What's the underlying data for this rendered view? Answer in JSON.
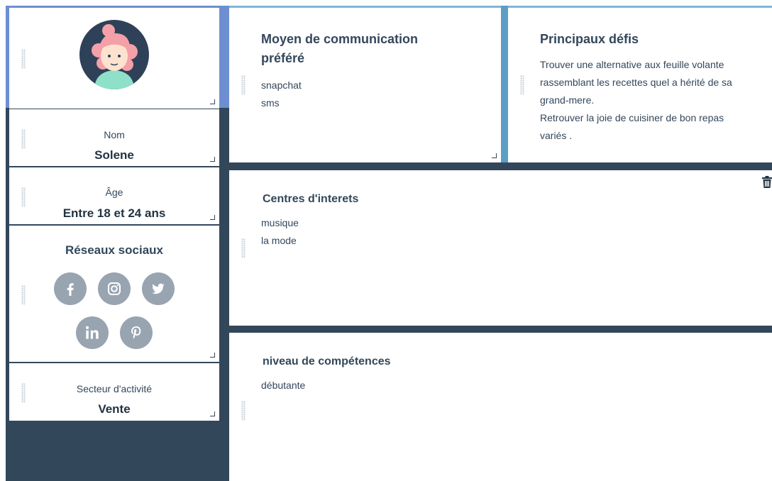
{
  "profile": {
    "name_label": "Nom",
    "name_value": "Solene",
    "age_label": "Âge",
    "age_value": "Entre 18 et 24 ans",
    "social_title": "Réseaux sociaux",
    "social_icons": [
      "facebook-icon",
      "instagram-icon",
      "twitter-icon",
      "linkedin-icon",
      "pinterest-icon"
    ],
    "sector_label": "Secteur d'activité",
    "sector_value": "Vente"
  },
  "communication": {
    "title": "Moyen de communication préféré",
    "items": [
      "snapchat",
      "sms"
    ]
  },
  "challenges": {
    "title": "Principaux défis",
    "text_1": "Trouver une alternative aux feuille volante rassemblant les recettes quel a hérité de sa grand-mere.",
    "text_2": "Retrouver la joie de cuisiner de bon repas variés ."
  },
  "interests": {
    "title": "Centres d'interets",
    "items": [
      "musique",
      "la mode"
    ]
  },
  "skills": {
    "title": "niveau de compétences",
    "value": "débutante"
  },
  "colors": {
    "dark_navy": "#33475b",
    "accent_blue": "#6d8fd1",
    "teal_strip": "#5c9ec6",
    "social_grey": "#99a4b1"
  }
}
